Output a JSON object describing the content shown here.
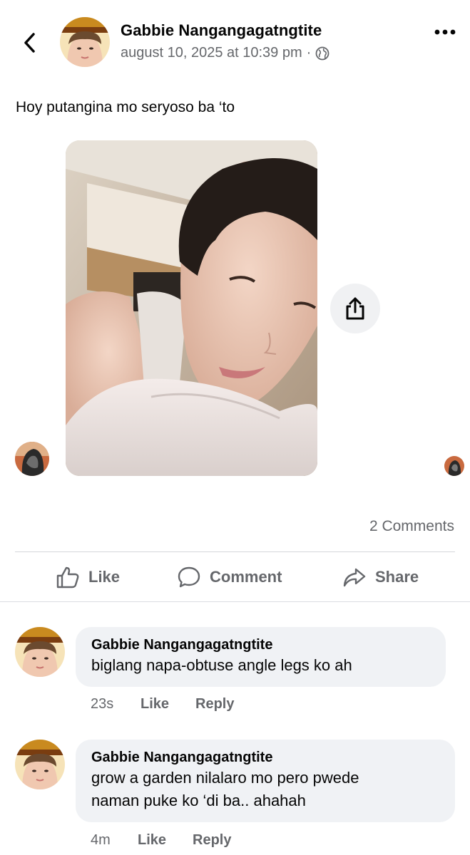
{
  "header": {
    "author": "Gabbie Nangangagatngtite",
    "timestamp": "august 10, 2025 at 10:39 pm",
    "separator": "·"
  },
  "post": {
    "text": "Hoy putangina mo seryoso ba ‘to"
  },
  "stats": {
    "comments": "2 Comments"
  },
  "actions": {
    "like": "Like",
    "comment": "Comment",
    "share": "Share"
  },
  "comments": [
    {
      "author": "Gabbie Nangangagatngtite",
      "text_lines": [
        "biglang napa-obtuse angle legs ko ah"
      ],
      "time": "23s",
      "like": "Like",
      "reply": "Reply"
    },
    {
      "author": "Gabbie Nangangagatngtite",
      "text_lines": [
        "grow a garden nilalaro mo pero pwede",
        "naman puke ko ‘di ba.. ahahah"
      ],
      "time": "4m",
      "like": "Like",
      "reply": "Reply"
    }
  ],
  "colors": {
    "secondary_text": "#65676b",
    "bubble_bg": "#f0f2f5",
    "divider": "#d5d7db"
  },
  "icons": [
    "back-arrow-icon",
    "more-dots-icon",
    "globe-icon",
    "share-upload-icon",
    "thumbs-up-icon",
    "comment-bubble-icon",
    "share-arrow-icon"
  ]
}
